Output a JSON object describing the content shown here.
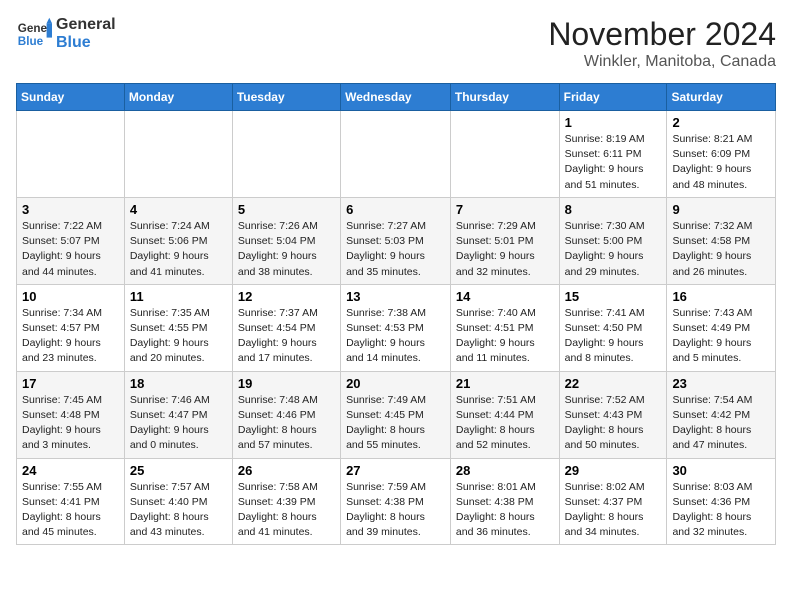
{
  "header": {
    "logo_general": "General",
    "logo_blue": "Blue",
    "month": "November 2024",
    "location": "Winkler, Manitoba, Canada"
  },
  "weekdays": [
    "Sunday",
    "Monday",
    "Tuesday",
    "Wednesday",
    "Thursday",
    "Friday",
    "Saturday"
  ],
  "weeks": [
    [
      {
        "day": "",
        "info": ""
      },
      {
        "day": "",
        "info": ""
      },
      {
        "day": "",
        "info": ""
      },
      {
        "day": "",
        "info": ""
      },
      {
        "day": "",
        "info": ""
      },
      {
        "day": "1",
        "info": "Sunrise: 8:19 AM\nSunset: 6:11 PM\nDaylight: 9 hours and 51 minutes."
      },
      {
        "day": "2",
        "info": "Sunrise: 8:21 AM\nSunset: 6:09 PM\nDaylight: 9 hours and 48 minutes."
      }
    ],
    [
      {
        "day": "3",
        "info": "Sunrise: 7:22 AM\nSunset: 5:07 PM\nDaylight: 9 hours and 44 minutes."
      },
      {
        "day": "4",
        "info": "Sunrise: 7:24 AM\nSunset: 5:06 PM\nDaylight: 9 hours and 41 minutes."
      },
      {
        "day": "5",
        "info": "Sunrise: 7:26 AM\nSunset: 5:04 PM\nDaylight: 9 hours and 38 minutes."
      },
      {
        "day": "6",
        "info": "Sunrise: 7:27 AM\nSunset: 5:03 PM\nDaylight: 9 hours and 35 minutes."
      },
      {
        "day": "7",
        "info": "Sunrise: 7:29 AM\nSunset: 5:01 PM\nDaylight: 9 hours and 32 minutes."
      },
      {
        "day": "8",
        "info": "Sunrise: 7:30 AM\nSunset: 5:00 PM\nDaylight: 9 hours and 29 minutes."
      },
      {
        "day": "9",
        "info": "Sunrise: 7:32 AM\nSunset: 4:58 PM\nDaylight: 9 hours and 26 minutes."
      }
    ],
    [
      {
        "day": "10",
        "info": "Sunrise: 7:34 AM\nSunset: 4:57 PM\nDaylight: 9 hours and 23 minutes."
      },
      {
        "day": "11",
        "info": "Sunrise: 7:35 AM\nSunset: 4:55 PM\nDaylight: 9 hours and 20 minutes."
      },
      {
        "day": "12",
        "info": "Sunrise: 7:37 AM\nSunset: 4:54 PM\nDaylight: 9 hours and 17 minutes."
      },
      {
        "day": "13",
        "info": "Sunrise: 7:38 AM\nSunset: 4:53 PM\nDaylight: 9 hours and 14 minutes."
      },
      {
        "day": "14",
        "info": "Sunrise: 7:40 AM\nSunset: 4:51 PM\nDaylight: 9 hours and 11 minutes."
      },
      {
        "day": "15",
        "info": "Sunrise: 7:41 AM\nSunset: 4:50 PM\nDaylight: 9 hours and 8 minutes."
      },
      {
        "day": "16",
        "info": "Sunrise: 7:43 AM\nSunset: 4:49 PM\nDaylight: 9 hours and 5 minutes."
      }
    ],
    [
      {
        "day": "17",
        "info": "Sunrise: 7:45 AM\nSunset: 4:48 PM\nDaylight: 9 hours and 3 minutes."
      },
      {
        "day": "18",
        "info": "Sunrise: 7:46 AM\nSunset: 4:47 PM\nDaylight: 9 hours and 0 minutes."
      },
      {
        "day": "19",
        "info": "Sunrise: 7:48 AM\nSunset: 4:46 PM\nDaylight: 8 hours and 57 minutes."
      },
      {
        "day": "20",
        "info": "Sunrise: 7:49 AM\nSunset: 4:45 PM\nDaylight: 8 hours and 55 minutes."
      },
      {
        "day": "21",
        "info": "Sunrise: 7:51 AM\nSunset: 4:44 PM\nDaylight: 8 hours and 52 minutes."
      },
      {
        "day": "22",
        "info": "Sunrise: 7:52 AM\nSunset: 4:43 PM\nDaylight: 8 hours and 50 minutes."
      },
      {
        "day": "23",
        "info": "Sunrise: 7:54 AM\nSunset: 4:42 PM\nDaylight: 8 hours and 47 minutes."
      }
    ],
    [
      {
        "day": "24",
        "info": "Sunrise: 7:55 AM\nSunset: 4:41 PM\nDaylight: 8 hours and 45 minutes."
      },
      {
        "day": "25",
        "info": "Sunrise: 7:57 AM\nSunset: 4:40 PM\nDaylight: 8 hours and 43 minutes."
      },
      {
        "day": "26",
        "info": "Sunrise: 7:58 AM\nSunset: 4:39 PM\nDaylight: 8 hours and 41 minutes."
      },
      {
        "day": "27",
        "info": "Sunrise: 7:59 AM\nSunset: 4:38 PM\nDaylight: 8 hours and 39 minutes."
      },
      {
        "day": "28",
        "info": "Sunrise: 8:01 AM\nSunset: 4:38 PM\nDaylight: 8 hours and 36 minutes."
      },
      {
        "day": "29",
        "info": "Sunrise: 8:02 AM\nSunset: 4:37 PM\nDaylight: 8 hours and 34 minutes."
      },
      {
        "day": "30",
        "info": "Sunrise: 8:03 AM\nSunset: 4:36 PM\nDaylight: 8 hours and 32 minutes."
      }
    ]
  ]
}
